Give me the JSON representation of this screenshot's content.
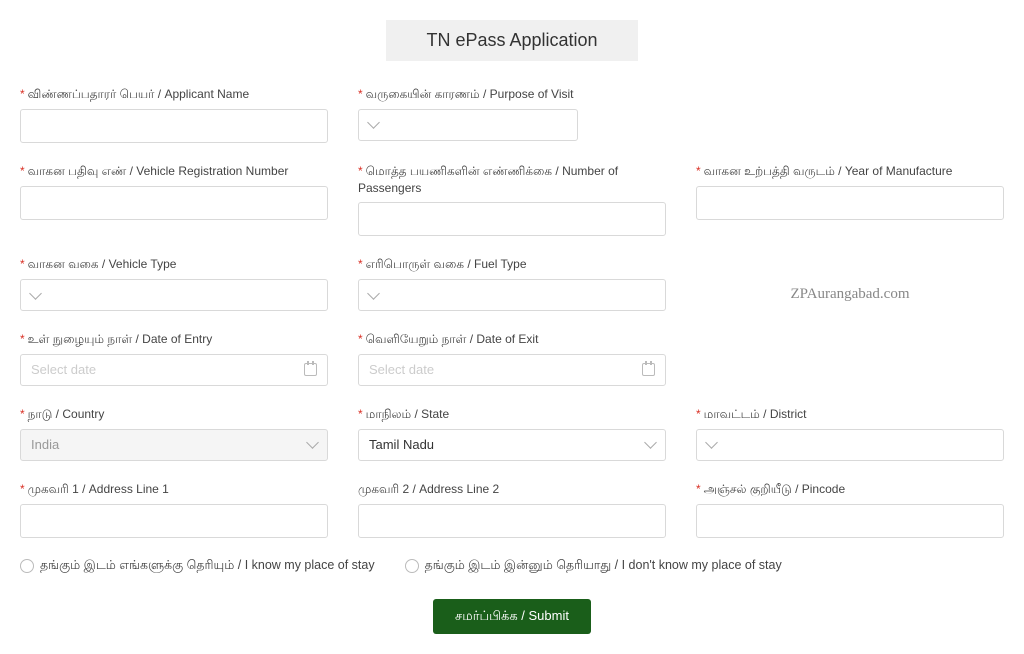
{
  "title": "TN ePass Application",
  "fields": {
    "applicant_name": {
      "label": "விண்ணப்பதாரர் பெயர் / Applicant Name",
      "required": true
    },
    "purpose": {
      "label": "வருகையின் காரணம் / Purpose of Visit",
      "required": true
    },
    "vehicle_reg": {
      "label": "வாகன பதிவு எண் / Vehicle Registration Number",
      "required": true
    },
    "passengers": {
      "label": "மொத்த பயணிகளின் எண்ணிக்கை / Number of Passengers",
      "required": true
    },
    "year_mfg": {
      "label": "வாகன உற்பத்தி வருடம் / Year of Manufacture",
      "required": true
    },
    "vehicle_type": {
      "label": "வாகன வகை / Vehicle Type",
      "required": true
    },
    "fuel_type": {
      "label": "எரிபொருள் வகை / Fuel Type",
      "required": true
    },
    "date_entry": {
      "label": "உள் நுழையும் நாள் / Date of Entry",
      "required": true,
      "placeholder": "Select date"
    },
    "date_exit": {
      "label": "வெளியேறும் நாள் / Date of Exit",
      "required": true,
      "placeholder": "Select date"
    },
    "country": {
      "label": "நாடு / Country",
      "required": true,
      "value": "India"
    },
    "state": {
      "label": "மாநிலம் / State",
      "required": true,
      "value": "Tamil Nadu"
    },
    "district": {
      "label": "மாவட்டம் / District",
      "required": true
    },
    "address1": {
      "label": "முகவரி 1 / Address Line 1",
      "required": true
    },
    "address2": {
      "label": "முகவரி 2 / Address Line 2",
      "required": false
    },
    "pincode": {
      "label": "அஞ்சல் குறியீடு / Pincode",
      "required": true
    }
  },
  "radio": {
    "know_stay": "தங்கும் இடம் எங்களுக்கு தெரியும் / I know my place of stay",
    "dont_know_stay": "தங்கும் இடம் இன்னும் தெரியாது / I don't know my place of stay"
  },
  "submit_label": "சமர்ப்பிக்க / Submit",
  "watermark": "ZPAurangabad.com"
}
